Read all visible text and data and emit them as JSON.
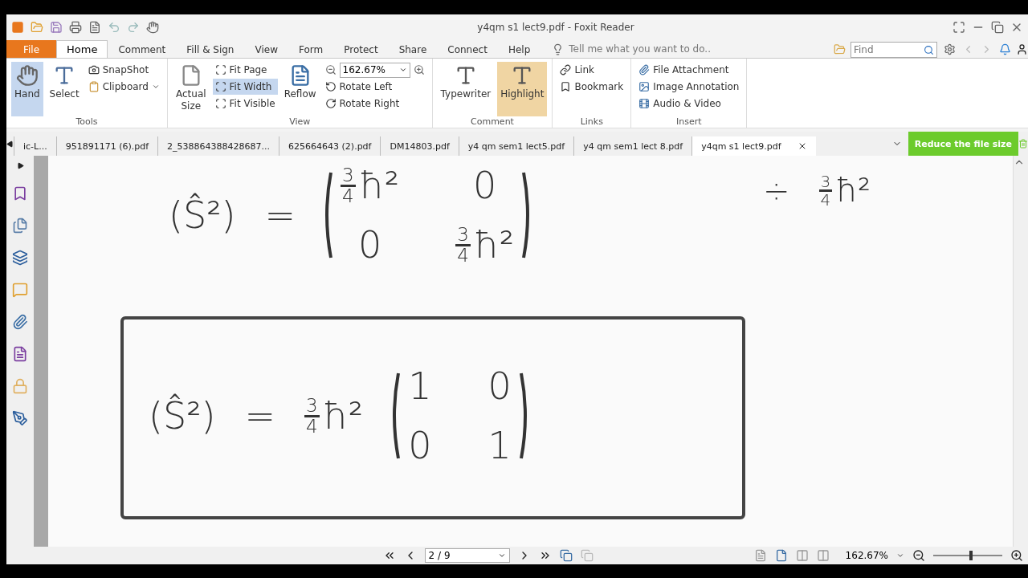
{
  "window": {
    "title": "y4qm s1 lect9.pdf - Foxit Reader"
  },
  "menu_tabs": [
    {
      "label": "File",
      "kind": "file",
      "selected": false
    },
    {
      "label": "Home",
      "kind": "tab",
      "selected": true
    },
    {
      "label": "Comment",
      "kind": "tab",
      "selected": false
    },
    {
      "label": "Fill & Sign",
      "kind": "tab",
      "selected": false
    },
    {
      "label": "View",
      "kind": "tab",
      "selected": false
    },
    {
      "label": "Form",
      "kind": "tab",
      "selected": false
    },
    {
      "label": "Protect",
      "kind": "tab",
      "selected": false
    },
    {
      "label": "Share",
      "kind": "tab",
      "selected": false
    },
    {
      "label": "Connect",
      "kind": "tab",
      "selected": false
    },
    {
      "label": "Help",
      "kind": "tab",
      "selected": false
    }
  ],
  "tell_me": {
    "placeholder": "Tell me what you want to do.."
  },
  "find": {
    "placeholder": "Find"
  },
  "ribbon": {
    "tools": {
      "label": "Tools",
      "hand": {
        "label": "Hand",
        "selected": true
      },
      "select": {
        "label": "Select"
      },
      "snapshot": "SnapShot",
      "clipboard": "Clipboard"
    },
    "view": {
      "label": "View",
      "actual_size": [
        "Actual",
        "Size"
      ],
      "fit": [
        {
          "label": "Fit Page",
          "selected": false
        },
        {
          "label": "Fit Width",
          "selected": true
        },
        {
          "label": "Fit Visible",
          "selected": false
        }
      ],
      "reflow": "Reflow",
      "zoom": "162.67%",
      "rotate_left": "Rotate Left",
      "rotate_right": "Rotate Right"
    },
    "comment": {
      "label": "Comment",
      "typewriter": {
        "label": "Typewriter",
        "selected": false
      },
      "highlight": {
        "label": "Highlight",
        "selected": true
      }
    },
    "links": {
      "label": "Links",
      "link": "Link",
      "bookmark": "Bookmark"
    },
    "insert": {
      "label": "Insert",
      "items": [
        "File Attachment",
        "Image Annotation",
        "Audio & Video"
      ]
    }
  },
  "doc_tabs": [
    {
      "label": "ic-L...",
      "selected": false
    },
    {
      "label": "951891171 (6).pdf",
      "selected": false
    },
    {
      "label": "2_538864388428687...",
      "selected": false
    },
    {
      "label": "625664643 (2).pdf",
      "selected": false
    },
    {
      "label": "DM14803.pdf",
      "selected": false
    },
    {
      "label": "y4 qm sem1 lect5.pdf",
      "selected": false
    },
    {
      "label": "y4 qm sem1 lect 8.pdf",
      "selected": false
    },
    {
      "label": "y4qm s1 lect9.pdf",
      "selected": true
    }
  ],
  "reduce_button": "Reduce the file size",
  "page": {
    "eq1": {
      "lhs": "(Ŝ²)",
      "eq": "=",
      "matrix": [
        [
          {
            "kind": "frac",
            "num": "3",
            "den": "4",
            "tail": "ħ²"
          },
          {
            "kind": "plain",
            "text": "0"
          }
        ],
        [
          {
            "kind": "plain",
            "text": "0"
          },
          {
            "kind": "frac",
            "num": "3",
            "den": "4",
            "tail": "ħ²"
          }
        ]
      ]
    },
    "note": {
      "sign": "÷",
      "num": "3",
      "den": "4",
      "tail": "ħ²"
    },
    "eq2": {
      "lhs": "(Ŝ²)",
      "eq": "=",
      "factor": {
        "num": "3",
        "den": "4",
        "tail": "ħ²"
      },
      "matrix": [
        [
          {
            "kind": "plain",
            "text": "1"
          },
          {
            "kind": "plain",
            "text": "0"
          }
        ],
        [
          {
            "kind": "plain",
            "text": "0"
          },
          {
            "kind": "plain",
            "text": "1"
          }
        ]
      ]
    }
  },
  "status_bar": {
    "page": "2 / 9",
    "zoom": "162.67%",
    "zoom_slider": {
      "level": 0.55
    }
  }
}
